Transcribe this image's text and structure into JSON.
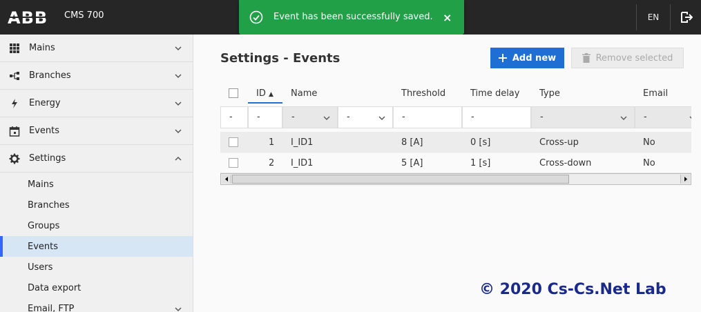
{
  "header": {
    "app_name": "CMS 700",
    "language": "EN"
  },
  "toast": {
    "message": "Event has been successfully saved.",
    "close": "×"
  },
  "sidebar": {
    "items": [
      {
        "label": "Mains",
        "icon": "grid-icon"
      },
      {
        "label": "Branches",
        "icon": "branches-icon"
      },
      {
        "label": "Energy",
        "icon": "lightning-icon"
      },
      {
        "label": "Events",
        "icon": "calendar-icon"
      },
      {
        "label": "Settings",
        "icon": "gear-icon"
      }
    ],
    "sub_items": [
      {
        "label": "Mains"
      },
      {
        "label": "Branches"
      },
      {
        "label": "Groups"
      },
      {
        "label": "Events"
      },
      {
        "label": "Users"
      },
      {
        "label": "Data export"
      },
      {
        "label": "Email, FTP"
      }
    ]
  },
  "main": {
    "title": "Settings - Events",
    "add_button": "Add new",
    "remove_button": "Remove selected"
  },
  "table": {
    "columns": [
      "ID",
      "Name",
      "Threshold",
      "Time delay",
      "Type",
      "Email"
    ],
    "filters": [
      "-",
      "-",
      "-",
      "-",
      "-",
      "-",
      "-",
      "-"
    ],
    "rows": [
      {
        "id": "1",
        "name": "I_ID1",
        "threshold": "8 [A]",
        "delay": "0 [s]",
        "type": "Cross-up",
        "email": "No"
      },
      {
        "id": "2",
        "name": "I_ID1",
        "threshold": "5 [A]",
        "delay": "1 [s]",
        "type": "Cross-down",
        "email": "No"
      }
    ]
  },
  "watermark": "© 2020 Cs-Cs.Net Lab",
  "colors": {
    "header_bg": "#262626",
    "toast_bg": "#21a047",
    "primary": "#1f6ed4",
    "active_nav": "#d6e6f5",
    "watermark": "#1a2a8c"
  }
}
